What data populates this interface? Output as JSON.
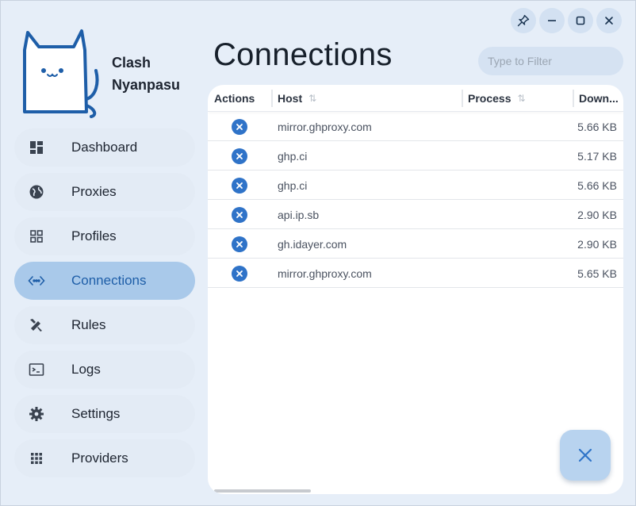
{
  "window": {
    "controls": [
      {
        "name": "pin-icon"
      },
      {
        "name": "minimize-icon"
      },
      {
        "name": "maximize-icon"
      },
      {
        "name": "close-icon"
      }
    ]
  },
  "brand": {
    "line1": "Clash",
    "line2": "Nyanpasu"
  },
  "sidebar": {
    "items": [
      {
        "label": "Dashboard",
        "icon": "dashboard-icon"
      },
      {
        "label": "Proxies",
        "icon": "globe-icon"
      },
      {
        "label": "Profiles",
        "icon": "grid-icon"
      },
      {
        "label": "Connections",
        "icon": "code-dots-icon",
        "active": true
      },
      {
        "label": "Rules",
        "icon": "tools-icon"
      },
      {
        "label": "Logs",
        "icon": "terminal-icon"
      },
      {
        "label": "Settings",
        "icon": "gear-icon"
      },
      {
        "label": "Providers",
        "icon": "apps-icon"
      }
    ]
  },
  "header": {
    "title": "Connections",
    "filter_placeholder": "Type to Filter"
  },
  "table": {
    "columns": [
      "Actions",
      "Host",
      "Process",
      "Down..."
    ],
    "rows": [
      {
        "host": "mirror.ghproxy.com",
        "process": "",
        "download": "5.66 KB"
      },
      {
        "host": "ghp.ci",
        "process": "",
        "download": "5.17 KB"
      },
      {
        "host": "ghp.ci",
        "process": "",
        "download": "5.66 KB"
      },
      {
        "host": "api.ip.sb",
        "process": "",
        "download": "2.90 KB"
      },
      {
        "host": "gh.idayer.com",
        "process": "",
        "download": "2.90 KB"
      },
      {
        "host": "mirror.ghproxy.com",
        "process": "",
        "download": "5.65 KB"
      }
    ]
  },
  "fab": {
    "icon": "close-all-icon"
  },
  "colors": {
    "background": "#e6eef8",
    "accent": "#2f73c8",
    "active_nav": "#a9c9ea"
  }
}
